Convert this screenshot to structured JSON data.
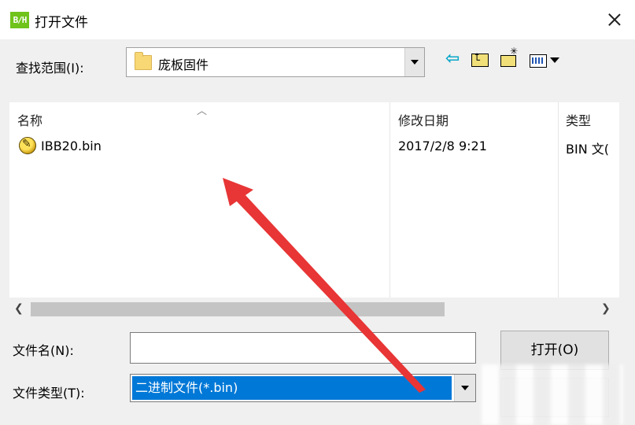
{
  "window": {
    "title": "打开文件",
    "app_icon_text": "B/H"
  },
  "lookin": {
    "label": "查找范围(I):",
    "value": "庞板固件"
  },
  "toolbar": {
    "icons": [
      "back-arrow-icon",
      "up-folder-icon",
      "new-folder-icon",
      "view-menu-icon"
    ]
  },
  "filelist": {
    "columns": [
      "名称",
      "修改日期",
      "类型"
    ],
    "rows": [
      {
        "name": "IBB20.bin",
        "modified": "2017/2/8 9:21",
        "type": "BIN 文("
      }
    ]
  },
  "filename": {
    "label": "文件名(N):",
    "value": ""
  },
  "filetype": {
    "label": "文件类型(T):",
    "value": "二进制文件(*.bin)"
  },
  "buttons": {
    "open": "打开(O)"
  },
  "colors": {
    "selection": "#0078d7",
    "annotation_arrow": "#e83535"
  }
}
